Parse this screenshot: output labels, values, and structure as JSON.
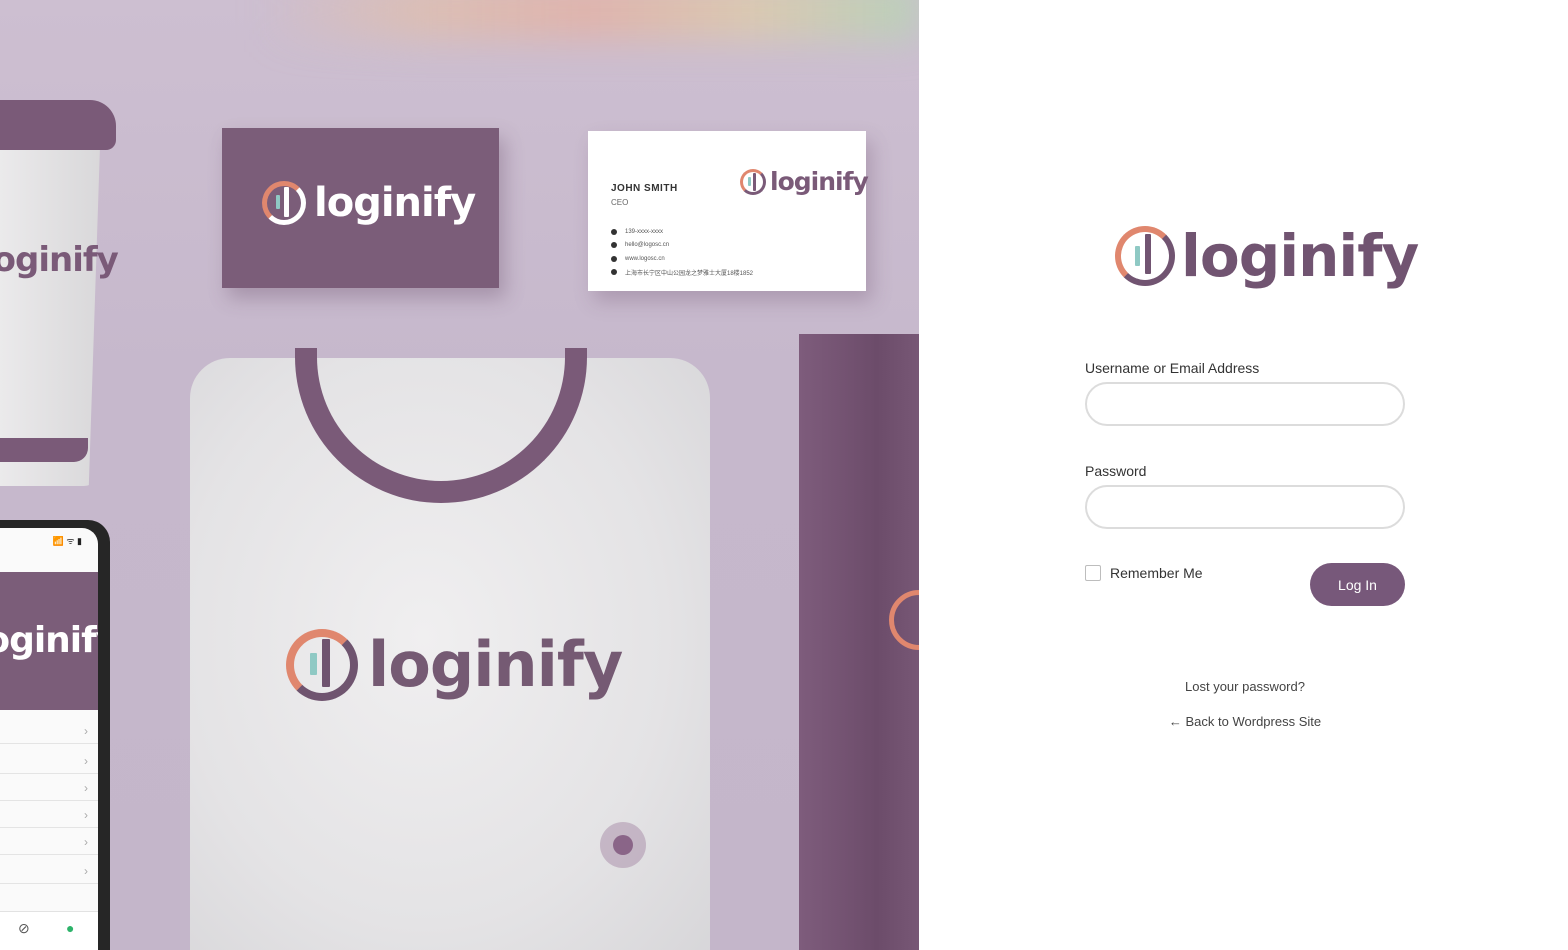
{
  "brand": {
    "name": "loginify",
    "colors": {
      "primary": "#77587a",
      "accent": "#e0876e",
      "teal": "#8fc9c4"
    }
  },
  "hero": {
    "business_card": {
      "name": "JOHN SMITH",
      "role": "CEO",
      "phone": "139-xxxx-xxxx",
      "email": "hello@logosc.cn",
      "web": "www.logosc.cn",
      "address": "上海市长宁区中山公园龙之梦雅士大厦18楼1852"
    },
    "phone_status": "📶 ᯤ ▮",
    "phone_row_arrow": "›"
  },
  "login": {
    "username_label": "Username or Email Address",
    "username_value": "",
    "password_label": "Password",
    "password_value": "",
    "remember_label": "Remember Me",
    "submit_label": "Log In",
    "lost_password": "Lost your password?",
    "back_link": "← Back to Wordpress Site"
  }
}
